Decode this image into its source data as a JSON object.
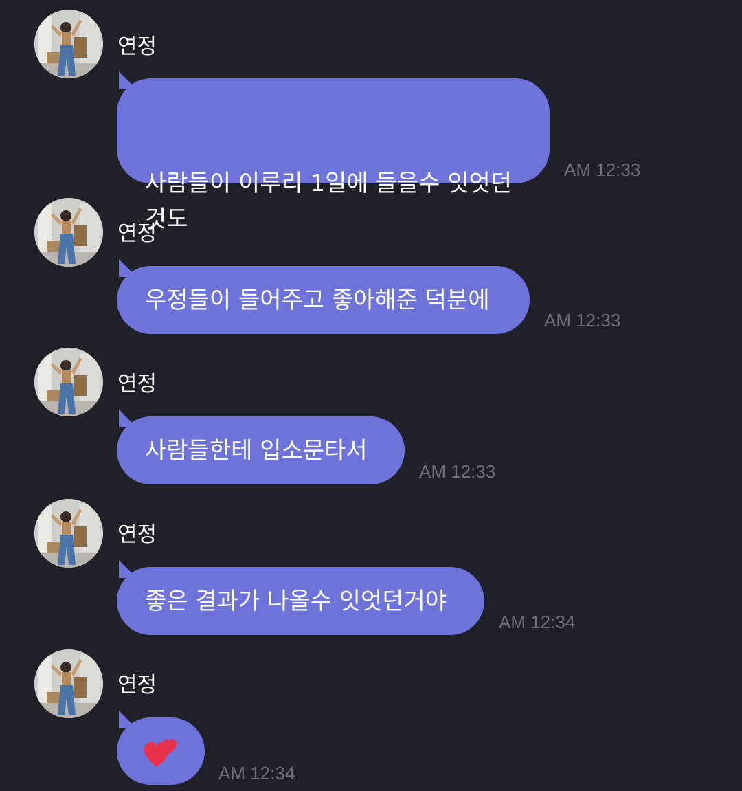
{
  "messages": [
    {
      "sender": "연정",
      "text": "사람들이 이루리 1일에 들을수 잇엇던\n것도",
      "time": "AM 12:33"
    },
    {
      "sender": "연정",
      "text": "우정들이 들어주고 좋아해준 덕분에",
      "time": "AM 12:33"
    },
    {
      "sender": "연정",
      "text": "사람들한테 입소문타서",
      "time": "AM 12:33"
    },
    {
      "sender": "연정",
      "text": "좋은 결과가 나올수 잇엇던거야",
      "time": "AM 12:34"
    },
    {
      "sender": "연정",
      "emoji": "two-hearts",
      "time": "AM 12:34"
    }
  ],
  "colors": {
    "background": "#202029",
    "bubble": "#6e73d9",
    "timestamp": "#6f6f78",
    "heart": "#e8304a"
  }
}
